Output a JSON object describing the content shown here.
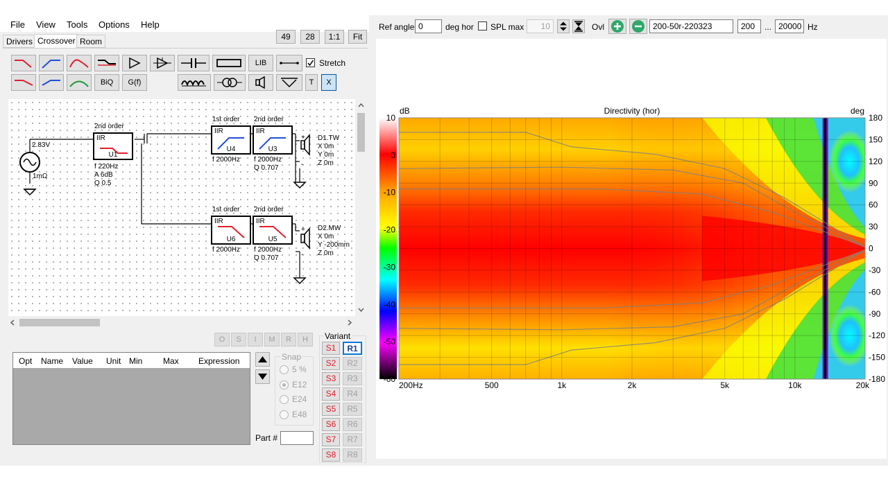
{
  "menu": [
    "File",
    "View",
    "Tools",
    "Options",
    "Help"
  ],
  "zoom_buttons": [
    "49",
    "28",
    "1:1",
    "Fit"
  ],
  "tabs": [
    "Drivers",
    "Crossover",
    "Room"
  ],
  "toolbar": {
    "lib": "LIB",
    "biq": "BiQ",
    "gf": "G(f)",
    "t": "T",
    "x": "X",
    "stretch": "Stretch"
  },
  "schematic": {
    "source_voltage": "2.83V",
    "source_impedance": "1mΩ",
    "blocks": [
      {
        "id": "U1",
        "order": "2nd order",
        "type": "IIR",
        "params": [
          "f  220Hz",
          "A  6dB",
          "Q  0.5"
        ]
      },
      {
        "id": "U4",
        "order": "1st order",
        "type": "IIR",
        "params": [
          "f  2000Hz"
        ]
      },
      {
        "id": "U3",
        "order": "2nd order",
        "type": "IIR",
        "params": [
          "f  2000Hz",
          "Q  0.707"
        ]
      },
      {
        "id": "U6",
        "order": "1st order",
        "type": "IIR",
        "params": [
          "f  2000Hz"
        ]
      },
      {
        "id": "U5",
        "order": "2nd order",
        "type": "IIR",
        "params": [
          "f  2000Hz",
          "Q  0.707"
        ]
      }
    ],
    "drivers": [
      {
        "name": "D1.TW",
        "x": "X  0m",
        "y": "Y  0m",
        "z": "Z  0m"
      },
      {
        "name": "D2.MW",
        "x": "X  0m",
        "y": "Y  -200mm",
        "z": "Z  0m"
      }
    ]
  },
  "opt_buttons": [
    "O",
    "S",
    "I",
    "M",
    "R",
    "H"
  ],
  "param_table": {
    "headers": [
      "Opt",
      "Name",
      "Value",
      "Unit",
      "Min",
      "Max",
      "Expression"
    ]
  },
  "snap": {
    "title": "Snap",
    "options": [
      "5 %",
      "E12",
      "E24",
      "E48"
    ],
    "selected": "E12"
  },
  "part_label": "Part #",
  "variant": {
    "title": "Variant",
    "s": [
      "S1",
      "S2",
      "S3",
      "S4",
      "S5",
      "S6",
      "S7",
      "S8"
    ],
    "r": [
      "R1",
      "R2",
      "R3",
      "R4",
      "R5",
      "R6",
      "R7",
      "R8"
    ],
    "active_r": "R1"
  },
  "top_toolbar": {
    "ref_angle_label": "Ref angle",
    "ref_angle_value": "0",
    "deg_hor": "deg hor",
    "spl_max_label": "SPL max",
    "spl_max_value": "10",
    "ovl_label": "Ovl",
    "overlay_name": "200-50r-220323",
    "f_min": "200",
    "ellipsis": "...",
    "f_max": "20000",
    "hz": "Hz"
  },
  "colors": {
    "accent_green": "#2fa86b",
    "active_variant": "#1a3f9d",
    "variant_s": "#e0202a"
  },
  "chart_data": {
    "type": "heatmap",
    "title": "Directivity (hor)",
    "ylabel_left": "dB",
    "ylabel_right": "deg",
    "x_ticks": [
      "200Hz",
      "500",
      "1k",
      "2k",
      "5k",
      "10k",
      "20k"
    ],
    "x_tick_values": [
      200,
      500,
      1000,
      2000,
      5000,
      10000,
      20000
    ],
    "xlim": [
      200,
      20000
    ],
    "x_scale": "log",
    "angle_ticks": [
      "180",
      "150",
      "120",
      "90",
      "60",
      "30",
      "0",
      "-30",
      "-60",
      "-90",
      "-120",
      "-150",
      "-180"
    ],
    "angle_range": [
      -180,
      180
    ],
    "db_ticks": [
      "10",
      "0",
      "-10",
      "-20",
      "-30",
      "-40",
      "-50",
      "-60"
    ],
    "db_range": [
      -60,
      10
    ],
    "colormap": [
      "#ffffff",
      "#ff0000",
      "#ffa000",
      "#ffff00",
      "#00ff00",
      "#00ffff",
      "#0000ff",
      "#ff00ff",
      "#000000"
    ],
    "grid": true
  }
}
